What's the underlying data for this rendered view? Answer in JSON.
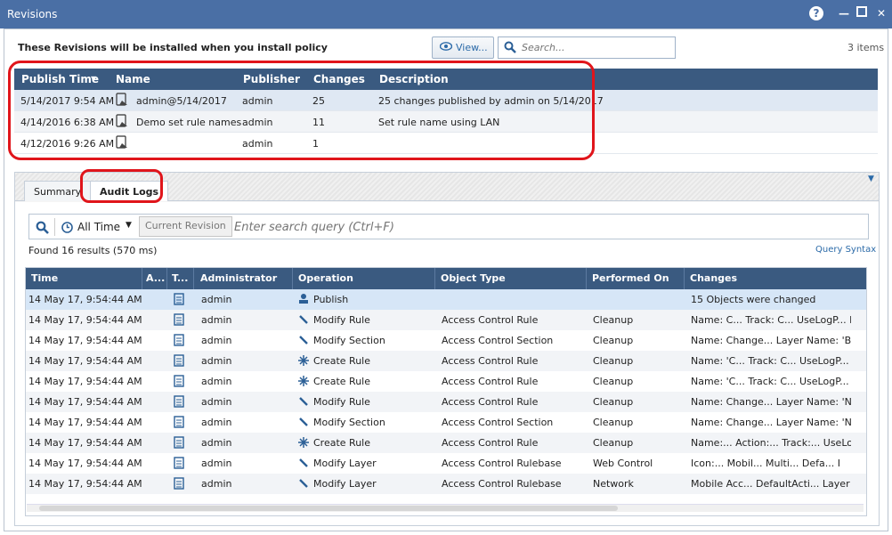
{
  "window": {
    "title": "Revisions",
    "help_icon": "question-icon",
    "controls": [
      "minimize-icon",
      "maximize-icon",
      "close-icon"
    ]
  },
  "toolbar": {
    "install_message": "These Revisions will be installed when you install policy",
    "view_button": "View...",
    "search_placeholder": "Search...",
    "items_count": "3 items"
  },
  "revisions": {
    "columns": [
      "Publish Time",
      "Name",
      "Publisher",
      "Changes",
      "Description"
    ],
    "rows": [
      {
        "publish_time": "5/14/2017 9:54 AM",
        "name": "admin@5/14/2017",
        "publisher": "admin",
        "changes": "25",
        "description": "25 changes published by admin on 5/14/2017"
      },
      {
        "publish_time": "4/14/2016 6:38 AM",
        "name": "Demo set rule names",
        "publisher": "admin",
        "changes": "11",
        "description": "Set rule name using LAN"
      },
      {
        "publish_time": "4/12/2016 9:26 AM",
        "name": "",
        "publisher": "admin",
        "changes": "1",
        "description": ""
      }
    ]
  },
  "tabs": [
    {
      "label": "Summary",
      "active": false
    },
    {
      "label": "Audit Logs",
      "active": true
    }
  ],
  "audit": {
    "time_filter": "All Time",
    "current_revision": "Current Revision",
    "query_placeholder": "Enter search query (Ctrl+F)",
    "results": "Found 16 results (570 ms)",
    "query_syntax": "Query Syntax",
    "columns": [
      "Time",
      "A...",
      "T...",
      "Administrator",
      "Operation",
      "Object Type",
      "Performed On",
      "Changes"
    ],
    "rows": [
      {
        "time": "14 May 17, 9:54:44 AM",
        "admin": "admin",
        "op_icon": "publish-icon",
        "operation": "Publish",
        "object_type": "",
        "performed_on": "",
        "changes": "15 Objects were changed"
      },
      {
        "time": "14 May 17, 9:54:44 AM",
        "admin": "admin",
        "op_icon": "pencil-icon",
        "operation": "Modify Rule",
        "object_type": "Access Control Rule",
        "performed_on": "Cleanup",
        "changes": "Name: C...  Track: C...  UseLogP...  L"
      },
      {
        "time": "14 May 17, 9:54:44 AM",
        "admin": "admin",
        "op_icon": "pencil-icon",
        "operation": "Modify Section",
        "object_type": "Access Control Section",
        "performed_on": "Cleanup",
        "changes": "Name: Change...  Layer Name: 'B...  L"
      },
      {
        "time": "14 May 17, 9:54:44 AM",
        "admin": "admin",
        "op_icon": "sparkle-icon",
        "operation": "Create Rule",
        "object_type": "Access Control Rule",
        "performed_on": "Cleanup",
        "changes": "Name: 'C...  Track: C...  UseLogP...  L"
      },
      {
        "time": "14 May 17, 9:54:44 AM",
        "admin": "admin",
        "op_icon": "sparkle-icon",
        "operation": "Create Rule",
        "object_type": "Access Control Rule",
        "performed_on": "Cleanup",
        "changes": "Name: 'C...  Track: C...  UseLogP...  L"
      },
      {
        "time": "14 May 17, 9:54:44 AM",
        "admin": "admin",
        "op_icon": "pencil-icon",
        "operation": "Modify Rule",
        "object_type": "Access Control Rule",
        "performed_on": "Cleanup",
        "changes": "Name: Change...  Layer Name: 'N...  L"
      },
      {
        "time": "14 May 17, 9:54:44 AM",
        "admin": "admin",
        "op_icon": "pencil-icon",
        "operation": "Modify Section",
        "object_type": "Access Control Section",
        "performed_on": "Cleanup",
        "changes": "Name: Change...  Layer Name: 'N...  L"
      },
      {
        "time": "14 May 17, 9:54:44 AM",
        "admin": "admin",
        "op_icon": "sparkle-icon",
        "operation": "Create Rule",
        "object_type": "Access Control Rule",
        "performed_on": "Cleanup",
        "changes": "Name:...  Action:...  Track:...  UseLo"
      },
      {
        "time": "14 May 17, 9:54:44 AM",
        "admin": "admin",
        "op_icon": "pencil-icon",
        "operation": "Modify Layer",
        "object_type": "Access Control Rulebase",
        "performed_on": "Web Control",
        "changes": "Icon:...  Mobil...  Multi...  Defa...  I"
      },
      {
        "time": "14 May 17, 9:54:44 AM",
        "admin": "admin",
        "op_icon": "pencil-icon",
        "operation": "Modify Layer",
        "object_type": "Access Control Rulebase",
        "performed_on": "Network",
        "changes": "Mobile Acc...  DefaultActi...  Layer Na"
      }
    ]
  },
  "colors": {
    "titlebar": "#4a6fa5",
    "header": "#3a5a80",
    "highlight_outline": "#e0151b",
    "link": "#2b6aa8"
  }
}
